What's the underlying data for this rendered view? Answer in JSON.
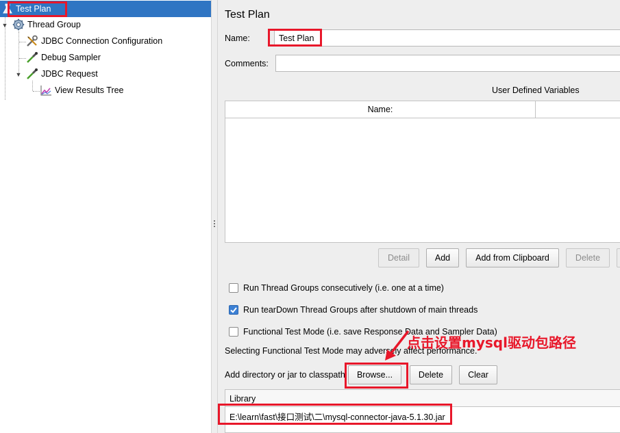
{
  "tree": {
    "items": [
      {
        "label": "Test Plan"
      },
      {
        "label": "Thread Group"
      },
      {
        "label": "JDBC Connection Configuration"
      },
      {
        "label": "Debug Sampler"
      },
      {
        "label": "JDBC Request"
      },
      {
        "label": "View Results Tree"
      }
    ]
  },
  "panel": {
    "title": "Test Plan",
    "name_label": "Name:",
    "name_value": "Test Plan",
    "comments_label": "Comments:",
    "comments_value": "",
    "udv_title": "User Defined Variables",
    "table_headers": [
      "Name:",
      ""
    ],
    "buttons": {
      "detail": "Detail",
      "add": "Add",
      "add_clipboard": "Add from Clipboard",
      "delete": "Delete"
    },
    "checkboxes": [
      {
        "label": "Run Thread Groups consecutively (i.e. one at a time)",
        "checked": false
      },
      {
        "label": "Run tearDown Thread Groups after shutdown of main threads",
        "checked": true
      },
      {
        "label": "Functional Test Mode (i.e. save Response Data and Sampler Data)",
        "checked": false
      }
    ],
    "functional_note": "Selecting Functional Test Mode may adversely affect performance.",
    "classpath_label": "Add directory or jar to classpath",
    "classpath_buttons": {
      "browse": "Browse...",
      "delete": "Delete",
      "clear": "Clear"
    },
    "library_header": "Library",
    "library_rows": [
      "E:\\learn\\fast\\接口测试\\二\\mysql-connector-java-5.1.30.jar"
    ]
  },
  "annotation": {
    "text": "点击设置mysql驱动包路径",
    "color": "#e8172a"
  },
  "colors": {
    "selection": "#2f75c3",
    "panel_bg": "#eeeeee",
    "checkbox_checked": "#3c80d4"
  }
}
